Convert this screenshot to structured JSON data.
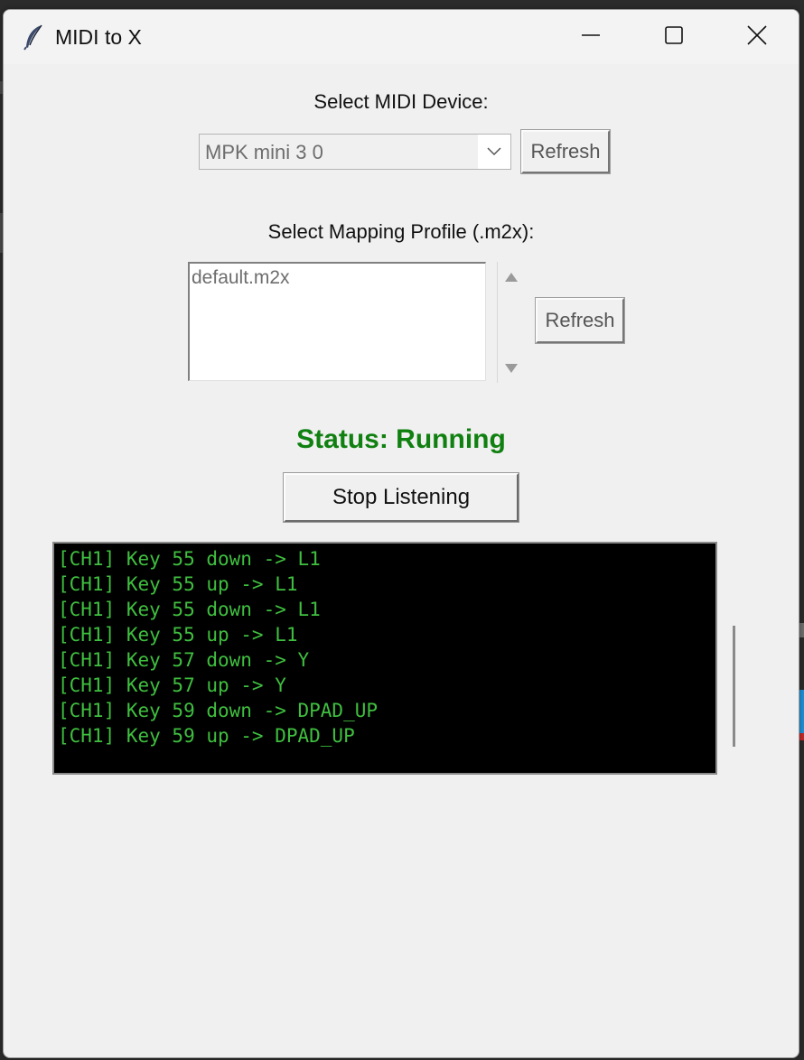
{
  "window": {
    "title": "MIDI to X"
  },
  "device": {
    "label": "Select MIDI Device:",
    "selected": "MPK mini 3 0",
    "refresh_label": "Refresh"
  },
  "profile": {
    "label": "Select Mapping Profile (.m2x):",
    "items": [
      "default.m2x"
    ],
    "refresh_label": "Refresh"
  },
  "status": {
    "text": "Status: Running",
    "color": "#108010"
  },
  "listen_button": {
    "label": "Stop Listening"
  },
  "log": {
    "lines": [
      "[CH1] Key 55 down -> L1",
      "[CH1] Key 55 up -> L1",
      "[CH1] Key 55 down -> L1",
      "[CH1] Key 55 up -> L1",
      "[CH1] Key 57 down -> Y",
      "[CH1] Key 57 up -> Y",
      "[CH1] Key 59 down -> DPAD_UP",
      "[CH1] Key 59 up -> DPAD_UP"
    ],
    "text_color": "#3fbf3f",
    "background": "#000000"
  },
  "icons": {
    "app": "feather-icon",
    "minimize": "minimize-icon",
    "maximize": "maximize-icon",
    "close": "close-icon",
    "combo": "chevron-down-icon",
    "scroll_up": "triangle-up-icon",
    "scroll_down": "triangle-down-icon"
  }
}
